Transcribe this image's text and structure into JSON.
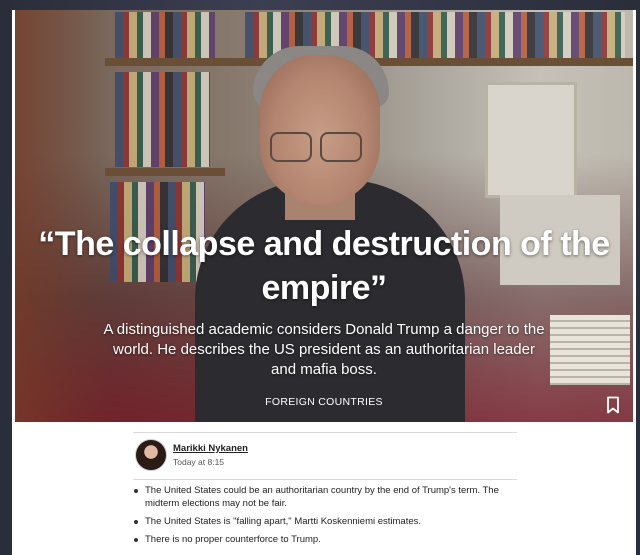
{
  "article": {
    "headline": "“The collapse and destruction of the empire”",
    "lede": "A distinguished academic considers Donald Trump a danger to the world. He describes the US president as an authoritarian leader and mafia boss.",
    "category": "FOREIGN COUNTRIES",
    "bookmark_icon": "bookmark-icon"
  },
  "byline": {
    "author": "Marikki Nykanen",
    "timestamp": "Today at 8:15"
  },
  "summary": [
    "The United States could be an authoritarian country by the end of Trump's term. The midterm elections may not be fair.",
    "The United States is \"falling apart,\" Martti Koskenniemi estimates.",
    "There is no proper counterforce to Trump."
  ],
  "colors": {
    "hero_overlay": "#6e0818",
    "text_on_hero": "#ffffff",
    "body_text": "#222222"
  }
}
